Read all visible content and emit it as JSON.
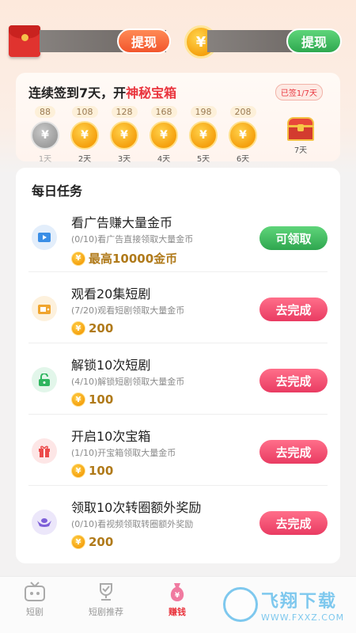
{
  "wallet": {
    "withdraw_left": "提现",
    "withdraw_right": "提现",
    "coin_symbol": "¥"
  },
  "checkin": {
    "title_prefix": "连续签到7天，开",
    "title_highlight": "神秘宝箱",
    "signed_badge": "已签1/7天",
    "days": [
      {
        "points": "88",
        "label": "1天",
        "state": "claimed"
      },
      {
        "points": "108",
        "label": "2天",
        "state": "pending"
      },
      {
        "points": "128",
        "label": "3天",
        "state": "pending"
      },
      {
        "points": "168",
        "label": "4天",
        "state": "pending"
      },
      {
        "points": "198",
        "label": "5天",
        "state": "pending"
      },
      {
        "points": "208",
        "label": "6天",
        "state": "pending"
      },
      {
        "points": "",
        "label": "7天",
        "state": "chest"
      }
    ]
  },
  "tasks": {
    "title": "每日任务",
    "items": [
      {
        "name": "看广告赚大量金币",
        "desc": "(0/10)看广告直接领取大量金币",
        "reward": "最高10000金币",
        "button": "可领取",
        "icon": "video-icon"
      },
      {
        "name": "观看20集短剧",
        "desc": "(7/20)观看短剧领取大量金币",
        "reward": "200",
        "button": "去完成",
        "icon": "tv-icon"
      },
      {
        "name": "解锁10次短剧",
        "desc": "(4/10)解锁短剧领取大量金币",
        "reward": "100",
        "button": "去完成",
        "icon": "unlock-icon"
      },
      {
        "name": "开启10次宝箱",
        "desc": "(1/10)开宝箱领取大量金币",
        "reward": "100",
        "button": "去完成",
        "icon": "gift-icon"
      },
      {
        "name": "领取10次转圈额外奖励",
        "desc": "(0/10)看视频领取转圈额外奖励",
        "reward": "200",
        "button": "去完成",
        "icon": "ingot-icon"
      }
    ]
  },
  "nav": {
    "items": [
      {
        "label": "短剧",
        "icon": "tv-icon"
      },
      {
        "label": "短剧推荐",
        "icon": "trophy-icon"
      },
      {
        "label": "赚钱",
        "icon": "money-bag-icon"
      }
    ]
  },
  "watermark": {
    "main": "飞翔下载",
    "sub": "WWW.FXXZ.COM"
  },
  "colors": {
    "accent_red": "#e9343d",
    "button_green": "#2fa64f",
    "button_pink": "#e93b62",
    "coin_gold": "#f5a00e"
  }
}
